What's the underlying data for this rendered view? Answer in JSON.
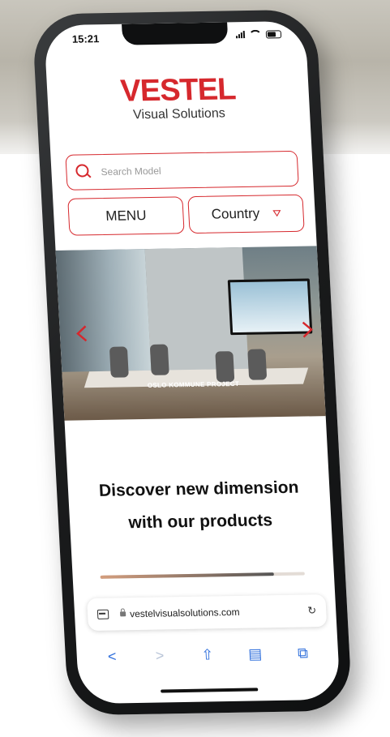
{
  "status": {
    "time": "15:21"
  },
  "brand": {
    "name": "VESTEL",
    "subtitle": "Visual Solutions",
    "color": "#d6282d"
  },
  "search": {
    "placeholder": "Search Model"
  },
  "nav": {
    "menu_label": "MENU",
    "country_label": "Country"
  },
  "hero": {
    "caption": "OSLO KOMMUNE PROJECT"
  },
  "headline": {
    "line1": "Discover new dimension",
    "line2": "with our products"
  },
  "slider": {
    "progress": 0.85
  },
  "browser": {
    "url": "vestelvisualsolutions.com"
  },
  "toolbar": {
    "back": "<",
    "forward": ">",
    "share_icon": "share-icon",
    "bookmarks_icon": "bookmarks-icon",
    "tabs_icon": "tabs-icon"
  },
  "colors": {
    "accent": "#d6282d",
    "ios_blue": "#2f6fdc"
  }
}
